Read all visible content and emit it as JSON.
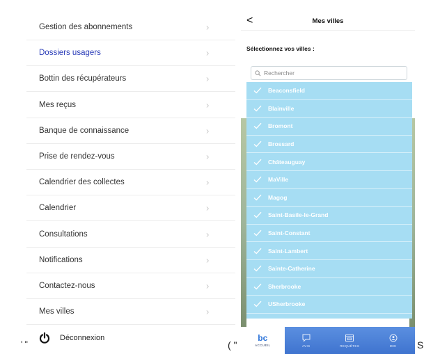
{
  "menu": {
    "items": [
      {
        "label": "Gestion des abonnements",
        "active": false
      },
      {
        "label": "Dossiers usagers",
        "active": true
      },
      {
        "label": "Bottin des récupérateurs",
        "active": false
      },
      {
        "label": "Mes reçus",
        "active": false
      },
      {
        "label": "Banque de connaissance",
        "active": false
      },
      {
        "label": "Prise de rendez-vous",
        "active": false
      },
      {
        "label": "Calendrier des collectes",
        "active": false
      },
      {
        "label": "Calendrier",
        "active": false
      },
      {
        "label": "Consultations",
        "active": false
      },
      {
        "label": "Notifications",
        "active": false
      },
      {
        "label": "Contactez-nous",
        "active": false
      },
      {
        "label": "Mes villes",
        "active": false
      }
    ],
    "chevron": "›",
    "logout_label": "Déconnexion"
  },
  "cities_screen": {
    "title": "Mes villes",
    "back_glyph": "<",
    "section_label": "Sélectionnez vos villes :",
    "search_placeholder": "Rechercher",
    "cities": [
      "Beaconsfield",
      "Blainville",
      "Bromont",
      "Brossard",
      "Châteauguay",
      "MaVille",
      "Magog",
      "Saint-Basile-le-Grand",
      "Saint-Constant",
      "Saint-Lambert",
      "Sainte-Catherine",
      "Sherbrooke",
      "USherbrooke"
    ],
    "tabs": [
      {
        "label": "ACCUEIL",
        "icon": "bc-logo",
        "active": true
      },
      {
        "label": "AVIS",
        "icon": "chat-icon",
        "active": false
      },
      {
        "label": "REQUÊTES",
        "icon": "requests-icon",
        "active": false
      },
      {
        "label": "MOI",
        "icon": "user-icon",
        "active": false
      }
    ],
    "logo_text": "bc"
  },
  "fragments": {
    "left_quotes": "' \"",
    "mid_quote": "( \"",
    "right_char": "S"
  },
  "colors": {
    "active_menu": "#2a3cb8",
    "city_list_bg": "#a6ddf3",
    "tab_bar": "#3f74cf"
  }
}
